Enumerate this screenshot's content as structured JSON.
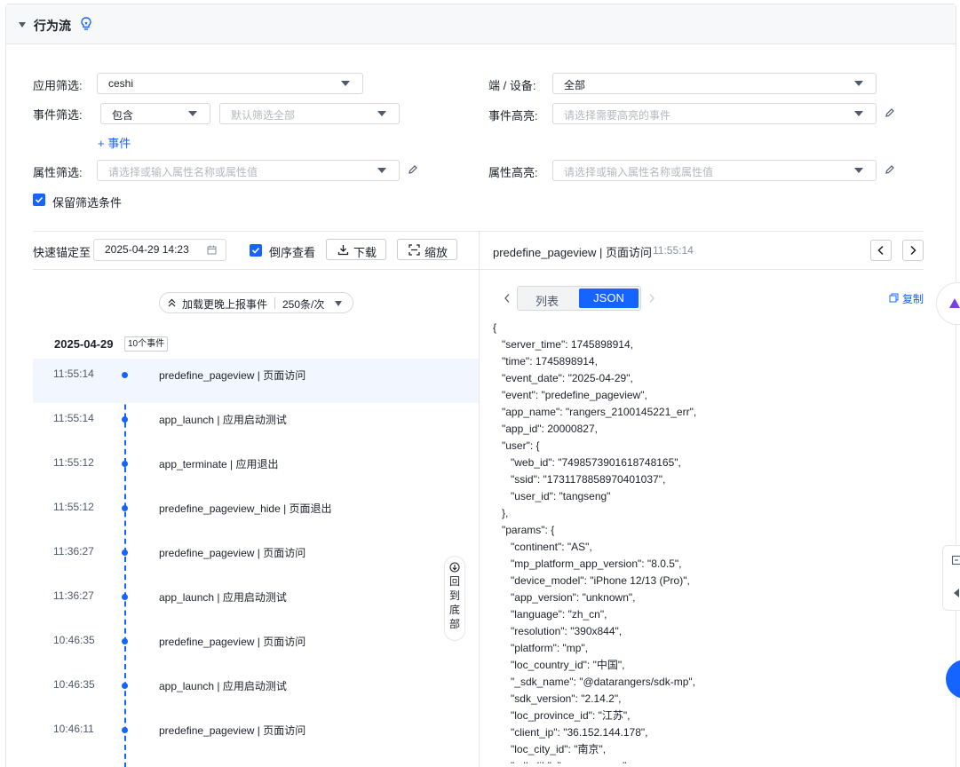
{
  "panel": {
    "title": "行为流"
  },
  "filters": {
    "app_label": "应用筛选:",
    "app_value": "ceshi",
    "device_label": "端 / 设备:",
    "device_value": "全部",
    "event_label": "事件筛选:",
    "event_mode": "包含",
    "event_placeholder": "默认筛选全部",
    "event_highlight_label": "事件高亮:",
    "event_highlight_placeholder": "请选择需要高亮的事件",
    "add_event": "+ 事件",
    "attr_label": "属性筛选:",
    "attr_placeholder": "请选择或输入属性名称或属性值",
    "attr_highlight_label": "属性高亮:",
    "attr_highlight_placeholder": "请选择或输入属性名称或属性值",
    "keep_label": "保留筛选条件"
  },
  "toolbar": {
    "anchor_label": "快速锚定至",
    "anchor_value": "2025-04-29 14:23",
    "reverse_label": "倒序查看",
    "download_label": "下载",
    "zoom_label": "缩放"
  },
  "timeline": {
    "load_more": "加载更晚上报事件",
    "page_size": "250条/次",
    "date": "2025-04-29",
    "count": "10个事件",
    "back_to_bottom": "回到底部",
    "events": [
      {
        "time": "11:55:14",
        "name": "predefine_pageview | 页面访问"
      },
      {
        "time": "11:55:14",
        "name": "app_launch | 应用启动测试"
      },
      {
        "time": "11:55:12",
        "name": "app_terminate | 应用退出"
      },
      {
        "time": "11:55:12",
        "name": "predefine_pageview_hide | 页面退出"
      },
      {
        "time": "11:36:27",
        "name": "predefine_pageview | 页面访问"
      },
      {
        "time": "11:36:27",
        "name": "app_launch | 应用启动测试"
      },
      {
        "time": "10:46:35",
        "name": "predefine_pageview | 页面访问"
      },
      {
        "time": "10:46:35",
        "name": "app_launch | 应用启动测试"
      },
      {
        "time": "10:46:11",
        "name": "predefine_pageview | 页面访问"
      }
    ]
  },
  "detail": {
    "title": "predefine_pageview | 页面访问",
    "time": "11:55:14",
    "tab_list": "列表",
    "tab_json": "JSON",
    "copy_label": "复制",
    "json_lines": [
      "{",
      "   \"server_time\": 1745898914,",
      "   \"time\": 1745898914,",
      "   \"event_date\": \"2025-04-29\",",
      "   \"event\": \"predefine_pageview\",",
      "   \"app_name\": \"rangers_2100145221_err\",",
      "   \"app_id\": 20000827,",
      "   \"user\": {",
      "      \"web_id\": \"7498573901618748165\",",
      "      \"ssid\": \"1731178858970401037\",",
      "      \"user_id\": \"tangseng\"",
      "   },",
      "   \"params\": {",
      "      \"continent\": \"AS\",",
      "      \"mp_platform_app_version\": \"8.0.5\",",
      "      \"device_model\": \"iPhone 12/13 (Pro)\",",
      "      \"app_version\": \"unknown\",",
      "      \"language\": \"zh_cn\",",
      "      \"resolution\": \"390x844\",",
      "      \"platform\": \"mp\",",
      "      \"loc_country_id\": \"中国\",",
      "      \"_sdk_name\": \"@datarangers/sdk-mp\",",
      "      \"sdk_version\": \"2.14.2\",",
      "      \"loc_province_id\": \"江苏\",",
      "      \"client_ip\": \"36.152.144.178\",",
      "      \"loc_city_id\": \"南京\",",
      "      \"sdk_lib\": \"mp_common\","
    ]
  }
}
